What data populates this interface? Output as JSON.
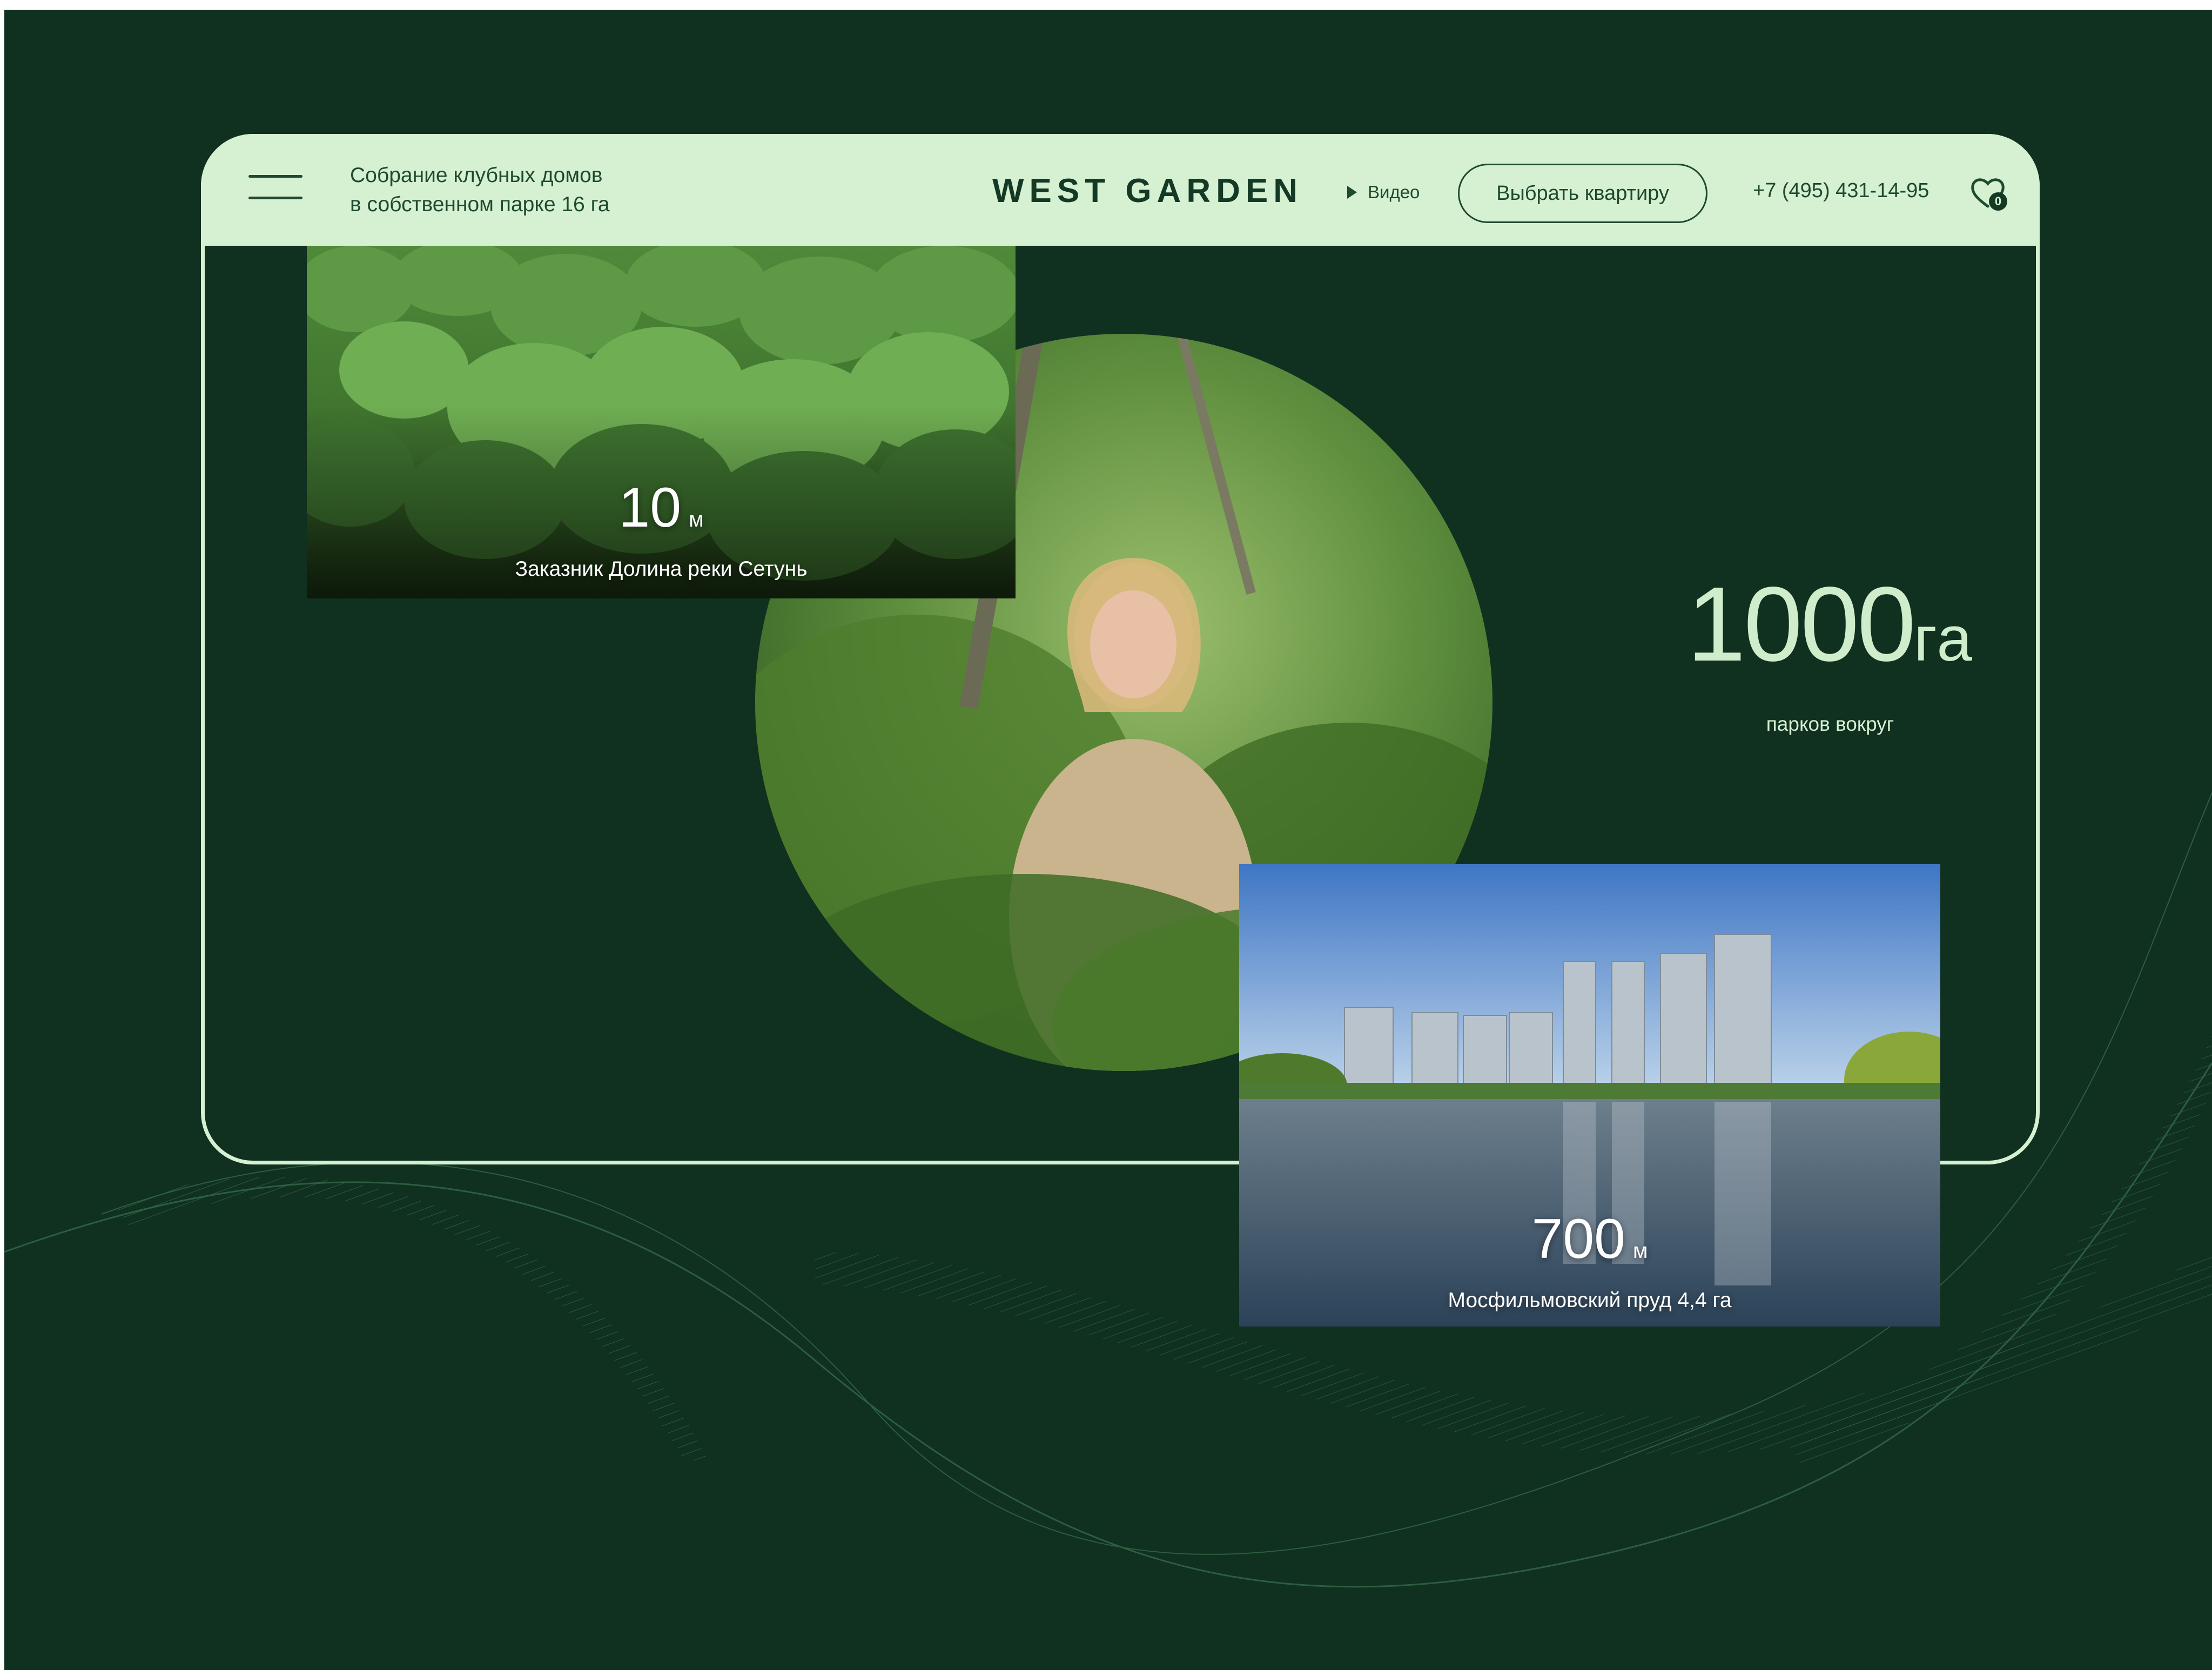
{
  "header": {
    "tagline_line1": "Собрание клубных домов",
    "tagline_line2": "в собственном парке 16 га",
    "brand": "WEST GARDEN",
    "video_label": "Видео",
    "cta_label": "Выбрать квартиру",
    "phone": "+7 (495) 431-14-95",
    "favorites_count": "0"
  },
  "stats": {
    "forest": {
      "value": "10",
      "unit": "м",
      "caption": "Заказник Долина реки Сетунь"
    },
    "parks": {
      "value": "1000",
      "unit": "га",
      "caption": "парков вокруг"
    },
    "pond": {
      "value": "700",
      "unit": "м",
      "caption": "Мосфильмовский пруд 4,4 га"
    }
  },
  "colors": {
    "background": "#103020",
    "accent": "#d6f0d2",
    "text_dark": "#1e4a2f"
  },
  "icons": [
    "menu-icon",
    "play-icon",
    "heart-icon"
  ]
}
